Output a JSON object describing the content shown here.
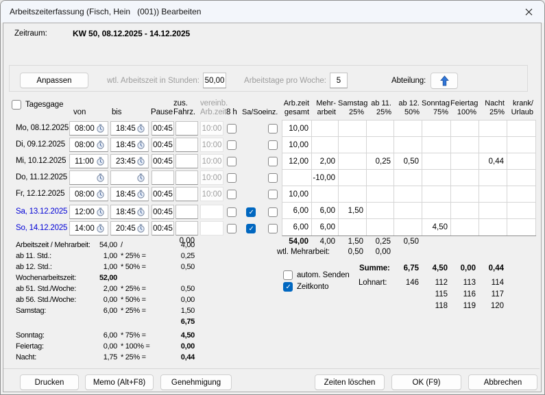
{
  "window": {
    "title": "Arbeitszeiterfassung (Fisch, Hein   (001)) Bearbeiten"
  },
  "zeitraum": {
    "label": "Zeitraum:",
    "value": "KW 50, 08.12.2025 - 14.12.2025"
  },
  "panel": {
    "anpassen": "Anpassen",
    "wtl_label": "wtl. Arbeitszeit in Stunden:",
    "wtl_value": "50,00",
    "tage_label": "Arbeitstage pro Woche:",
    "tage_value": "5",
    "abteilung_label": "Abteilung:"
  },
  "table": {
    "tagesgage": "Tagesgage",
    "col_headers": {
      "von": "von",
      "bis": "bis",
      "pause": "Pause",
      "zus1": "zus.",
      "zus2": "Fahrz.",
      "ver1": "vereinb.",
      "ver2": "Arb.zeit",
      "h8": "8 h",
      "saso": "Sa/Soeinz."
    },
    "grid_headers": [
      {
        "l1": "Arb.zeit",
        "l2": "gesamt"
      },
      {
        "l1": "Mehr-",
        "l2": "arbeit"
      },
      {
        "l1": "Samstag",
        "l2": "25%"
      },
      {
        "l1": "ab 11.",
        "l2": "25%"
      },
      {
        "l1": "ab 12.",
        "l2": "50%"
      },
      {
        "l1": "Sonntag",
        "l2": "75%"
      },
      {
        "l1": "Feiertag",
        "l2": "100%"
      },
      {
        "l1": "Nacht",
        "l2": "25%"
      },
      {
        "l1": "krank/",
        "l2": "Urlaub"
      }
    ],
    "days": [
      {
        "label": "Mo, 08.12.2025",
        "von": "08:00",
        "bis": "18:45",
        "pause": "00:45",
        "fahrz": "",
        "vereinb": "10:00",
        "h8": false,
        "saso": null,
        "einz": false,
        "cols": [
          "10,00",
          "",
          "",
          "",
          "",
          "",
          "",
          "",
          ""
        ]
      },
      {
        "label": "Di, 09.12.2025",
        "von": "08:00",
        "bis": "18:45",
        "pause": "00:45",
        "fahrz": "",
        "vereinb": "10:00",
        "h8": false,
        "saso": null,
        "einz": false,
        "cols": [
          "10,00",
          "",
          "",
          "",
          "",
          "",
          "",
          "",
          ""
        ]
      },
      {
        "label": "Mi, 10.12.2025",
        "von": "11:00",
        "bis": "23:45",
        "pause": "00:45",
        "fahrz": "",
        "vereinb": "10:00",
        "h8": false,
        "saso": null,
        "einz": false,
        "cols": [
          "12,00",
          "2,00",
          "",
          "0,25",
          "0,50",
          "",
          "",
          "0,44",
          ""
        ]
      },
      {
        "label": "Do, 11.12.2025",
        "von": "",
        "bis": "",
        "pause": "",
        "fahrz": "",
        "vereinb": "10:00",
        "h8": false,
        "saso": null,
        "einz": false,
        "cols": [
          "",
          "-10,00",
          "",
          "",
          "",
          "",
          "",
          "",
          ""
        ]
      },
      {
        "label": "Fr, 12.12.2025",
        "von": "08:00",
        "bis": "18:45",
        "pause": "00:45",
        "fahrz": "",
        "vereinb": "10:00",
        "h8": false,
        "saso": null,
        "einz": false,
        "cols": [
          "10,00",
          "",
          "",
          "",
          "",
          "",
          "",
          "",
          ""
        ]
      },
      {
        "label": "Sa, 13.12.2025",
        "von": "12:00",
        "bis": "18:45",
        "pause": "00:45",
        "fahrz": "",
        "vereinb": "",
        "h8": false,
        "saso": true,
        "einz": false,
        "cols": [
          "6,00",
          "6,00",
          "1,50",
          "",
          "",
          "",
          "",
          "",
          ""
        ]
      },
      {
        "label": "So, 14.12.2025",
        "von": "14:00",
        "bis": "20:45",
        "pause": "00:45",
        "fahrz": "",
        "vereinb": "",
        "h8": false,
        "saso": true,
        "einz": false,
        "cols": [
          "6,00",
          "6,00",
          "",
          "",
          "",
          "4,50",
          "",
          "",
          ""
        ]
      }
    ],
    "fahrz_sum": "0,00",
    "totals": [
      "54,00",
      "4,00",
      "1,50",
      "0,25",
      "0,50"
    ],
    "wtl_mehr": {
      "label": "wtl. Mehrarbeit:",
      "v1": "0,50",
      "v2": "0,00"
    }
  },
  "summary": {
    "rows": [
      {
        "label": "Arbeitszeit / Mehrarbeit:",
        "value": "54,00",
        "formula": "/",
        "result": "4,00"
      },
      {
        "label": "ab 11. Std.:",
        "value": "1,00",
        "formula": "* 25% =",
        "result": "0,25"
      },
      {
        "label": "ab 12. Std.:",
        "value": "1,00",
        "formula": "* 50% =",
        "result": "0,50"
      },
      {
        "label": "Wochenarbeitszeit:",
        "value": "52,00",
        "formula": "",
        "result": ""
      },
      {
        "label": "ab 51. Std./Woche:",
        "value": "2,00",
        "formula": "* 25% =",
        "result": "0,50"
      },
      {
        "label": "ab 56. Std./Woche:",
        "value": "0,00",
        "formula": "* 50% =",
        "result": "0,00"
      },
      {
        "label": "Samstag:",
        "value": "6,00",
        "formula": "* 25% =",
        "result": "1,50"
      },
      {
        "label": "",
        "value": "",
        "formula": "",
        "result": "6,75"
      },
      {
        "label": "Sonntag:",
        "value": "6,00",
        "formula": "* 75% =",
        "result": "4,50"
      },
      {
        "label": "Feiertag:",
        "value": "0,00",
        "formula": "* 100% =",
        "result": "0,00"
      },
      {
        "label": "Nacht:",
        "value": "1,75",
        "formula": "* 25% =",
        "result": "0,44"
      }
    ]
  },
  "right": {
    "autom": "autom. Senden",
    "zeitkonto": "Zeitkonto",
    "summe_label": "Summe:",
    "summe": [
      "6,75",
      "4,50",
      "0,00",
      "0,44"
    ],
    "lohnart_label": "Lohnart:",
    "lohnart": [
      [
        "146",
        "112",
        "113",
        "114"
      ],
      [
        "115",
        "116",
        "117"
      ],
      [
        "118",
        "119",
        "120"
      ]
    ]
  },
  "buttons": {
    "drucken": "Drucken",
    "memo": "Memo (Alt+F8)",
    "genehmigung": "Genehmigung",
    "zeiten": "Zeiten löschen",
    "ok": "OK (F9)",
    "abbrechen": "Abbrechen"
  }
}
